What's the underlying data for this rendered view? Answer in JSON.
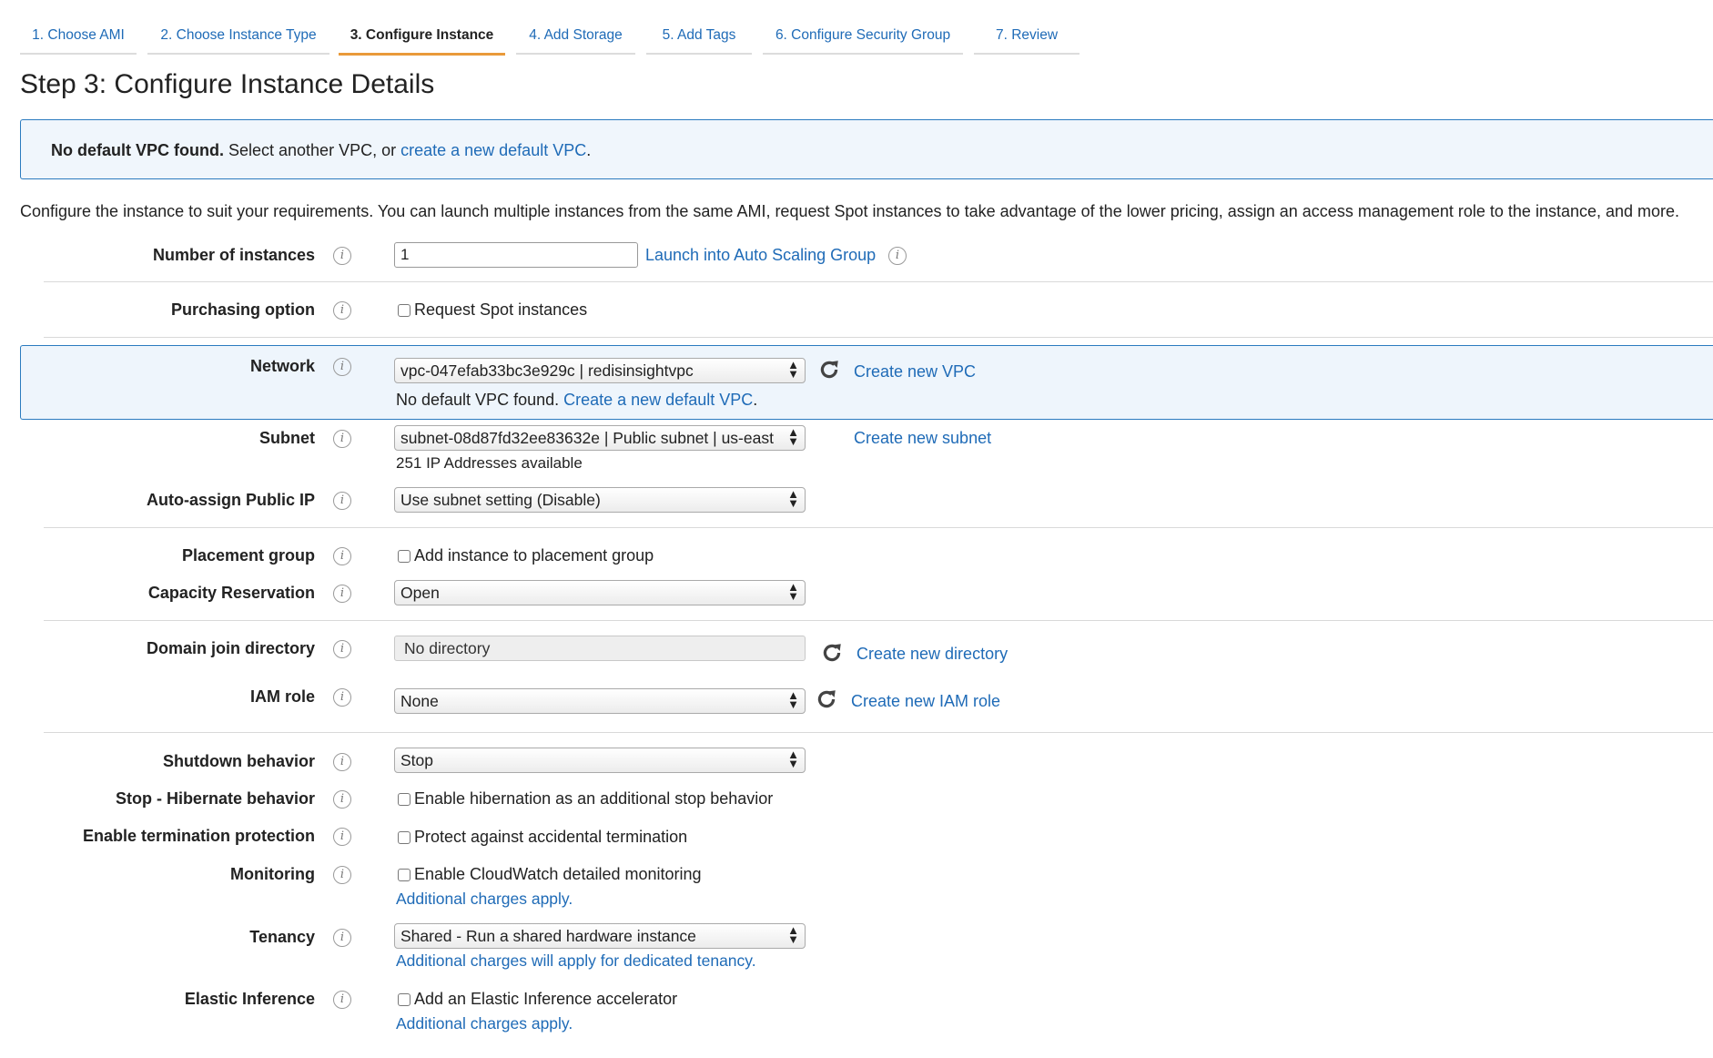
{
  "tabs": [
    {
      "label": "1. Choose AMI"
    },
    {
      "label": "2. Choose Instance Type"
    },
    {
      "label": "3. Configure Instance"
    },
    {
      "label": "4. Add Storage"
    },
    {
      "label": "5. Add Tags"
    },
    {
      "label": "6. Configure Security Group"
    },
    {
      "label": "7. Review"
    }
  ],
  "page_title": "Step 3: Configure Instance Details",
  "alert": {
    "bold": "No default VPC found.",
    "text": " Select another VPC, or ",
    "link": "create a new default VPC",
    "tail": "."
  },
  "intro": "Configure the instance to suit your requirements. You can launch multiple instances from the same AMI, request Spot instances to take advantage of the lower pricing, assign an access management role to the instance, and more.",
  "fields": {
    "instances": {
      "label": "Number of instances",
      "value": "1",
      "link": "Launch into Auto Scaling Group"
    },
    "purchasing": {
      "label": "Purchasing option",
      "checkbox": "Request Spot instances"
    },
    "network": {
      "label": "Network",
      "value": "vpc-047efab33bc3e929c | redisinsightvpc",
      "link": "Create new VPC",
      "note_text": "No default VPC found. ",
      "note_link": "Create a new default VPC",
      "note_tail": "."
    },
    "subnet": {
      "label": "Subnet",
      "value": "subnet-08d87fd32ee83632e | Public subnet | us-east",
      "link": "Create new subnet",
      "note": "251 IP Addresses available"
    },
    "public_ip": {
      "label": "Auto-assign Public IP",
      "value": "Use subnet setting (Disable)"
    },
    "placement": {
      "label": "Placement group",
      "checkbox": "Add instance to placement group"
    },
    "capacity": {
      "label": "Capacity Reservation",
      "value": "Open"
    },
    "domain": {
      "label": "Domain join directory",
      "value": "No directory",
      "link": "Create new directory"
    },
    "iam": {
      "label": "IAM role",
      "value": "None",
      "link": "Create new IAM role"
    },
    "shutdown": {
      "label": "Shutdown behavior",
      "value": "Stop"
    },
    "hibernate": {
      "label": "Stop - Hibernate behavior",
      "checkbox": "Enable hibernation as an additional stop behavior"
    },
    "termination": {
      "label": "Enable termination protection",
      "checkbox": "Protect against accidental termination"
    },
    "monitoring": {
      "label": "Monitoring",
      "checkbox": "Enable CloudWatch detailed monitoring",
      "link": "Additional charges apply."
    },
    "tenancy": {
      "label": "Tenancy",
      "value": "Shared - Run a shared hardware instance",
      "link": "Additional charges will apply for dedicated tenancy."
    },
    "inference": {
      "label": "Elastic Inference",
      "checkbox": "Add an Elastic Inference accelerator",
      "link": "Additional charges apply."
    }
  },
  "colors": {
    "link": "#1f6bb7",
    "active_tab": "#e99a3a",
    "alert_border": "#2b7bbf",
    "alert_bg": "#f0f6fc"
  },
  "icons": {
    "info": "info-icon",
    "refresh": "refresh-icon",
    "select_arrow": "updown-arrow-icon"
  }
}
